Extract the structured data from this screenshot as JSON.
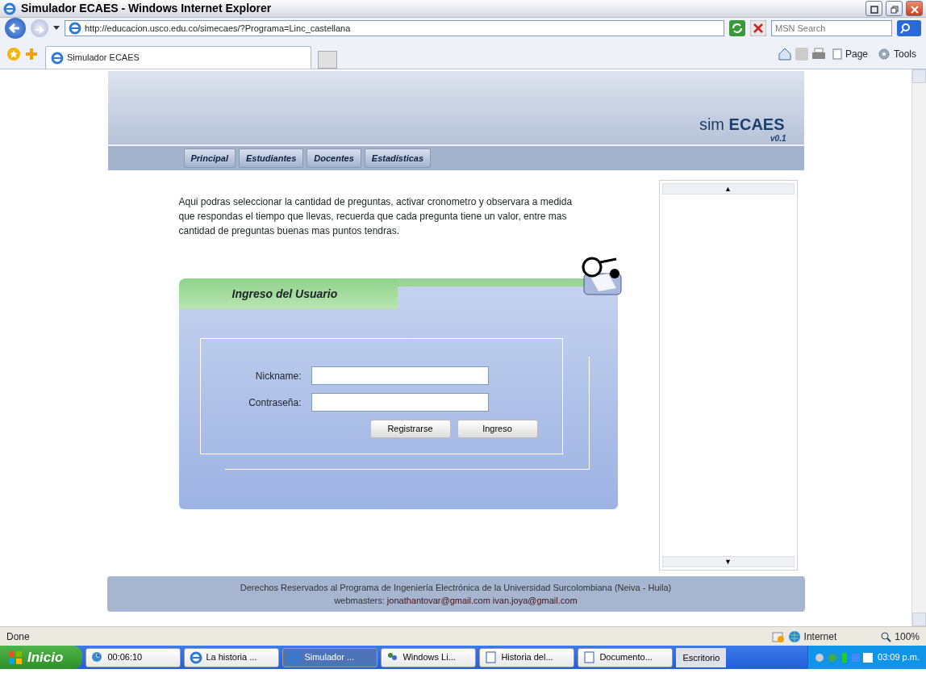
{
  "window": {
    "title": "Simulador ECAES - Windows Internet Explorer"
  },
  "address_bar": {
    "url": "http://educacion.usco.edu.co/simecaes/?Programa=Linc_castellana"
  },
  "search": {
    "placeholder": "MSN Search"
  },
  "browser_tabs": [
    {
      "label": "Simulador ECAES",
      "selected": true
    }
  ],
  "command_bar": [
    "Page",
    "Tools"
  ],
  "page": {
    "brand_light": "sim",
    "brand_bold": "ECAES",
    "version": "v0.1",
    "nav": [
      "Principal",
      "Estudiantes",
      "Docentes",
      "Estadísticas"
    ],
    "intro": "Aqui podras seleccionar la cantidad de preguntas, activar cronometro y observara a medida que respondas el tiempo que llevas, recuerda que cada pregunta tiene un valor, entre mas cantidad de preguntas buenas mas puntos tendras.",
    "login": {
      "title": "Ingreso del Usuario",
      "fields": [
        {
          "label": "Nickname:"
        },
        {
          "label": "Contraseña:"
        }
      ],
      "buttons": [
        "Registrarse",
        "Ingreso"
      ]
    },
    "side_panel": {
      "up": "▲",
      "down": "▼"
    },
    "footer": {
      "line": "Derechos Reservados al Programa de Ingeniería Electrónica de la Universidad Surcolombiana (Neiva - Huila)",
      "label": "webmasters:",
      "emails": [
        "jonathantovar@gmail.com",
        "ivan.joya@gmail.com"
      ]
    }
  },
  "status_bar": {
    "text": "Done",
    "zone": "Internet",
    "zoom": "100%"
  },
  "taskbar": {
    "start": "Inicio",
    "items": [
      {
        "label": "00:06:10",
        "selected": false
      },
      {
        "label": "La historia ...",
        "selected": false
      },
      {
        "label": "Simulador ...",
        "selected": true
      },
      {
        "label": "Windows Li...",
        "selected": false
      },
      {
        "label": "Historia del...",
        "selected": false
      },
      {
        "label": "Documento...",
        "selected": false
      }
    ],
    "desktop": "Escritorio",
    "clock": "03:09 p.m."
  }
}
